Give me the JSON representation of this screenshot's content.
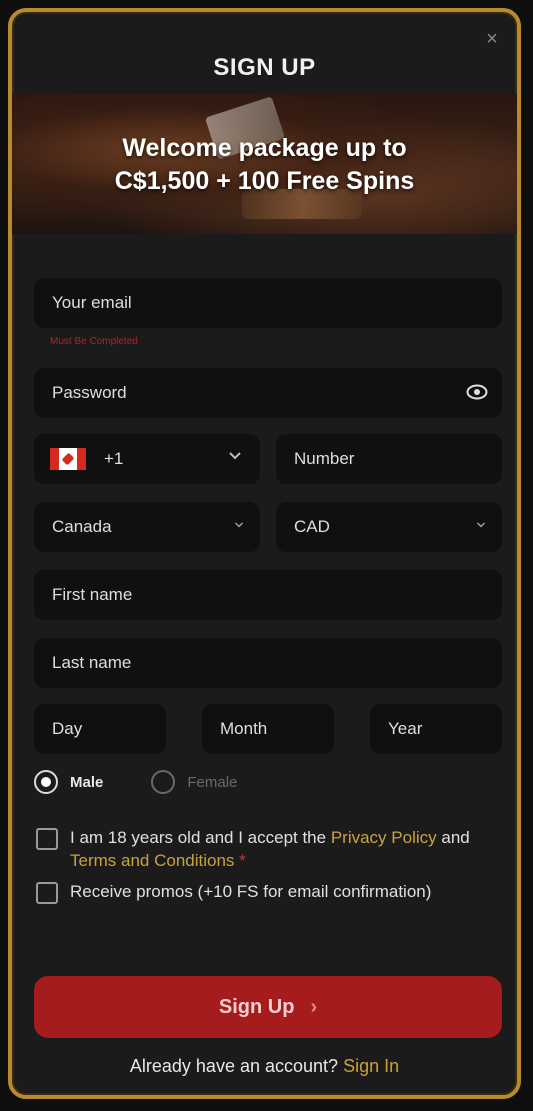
{
  "modal": {
    "title": "SIGN UP",
    "close_icon": "×"
  },
  "banner": {
    "headline_line1": "Welcome package up to",
    "headline_line2": "C$1,500 + 100 Free Spins"
  },
  "form": {
    "email_placeholder": "Your email",
    "email_error": "Must Be Completed",
    "password_placeholder": "Password",
    "phone_code": "+1",
    "phone_placeholder": "Number",
    "country_value": "Canada",
    "currency_value": "CAD",
    "first_name_placeholder": "First name",
    "last_name_placeholder": "Last name",
    "day_placeholder": "Day",
    "month_placeholder": "Month",
    "year_placeholder": "Year",
    "gender_male": "Male",
    "gender_female": "Female",
    "terms_text_1": "I am 18 years old and I accept the ",
    "privacy_link": "Privacy Policy",
    "terms_text_2": " and ",
    "terms_link": "Terms and Conditions",
    "required_mark": "*",
    "promos_text": "Receive promos (+10 FS for email confirmation)",
    "submit_label": "Sign Up",
    "submit_arrow": "›"
  },
  "footer": {
    "prompt": "Already have an account?",
    "signin_link": "Sign In"
  },
  "colors": {
    "accent_gold": "#b98a2d",
    "button_red": "#a61b1b",
    "link_gold": "#c9a23a"
  }
}
